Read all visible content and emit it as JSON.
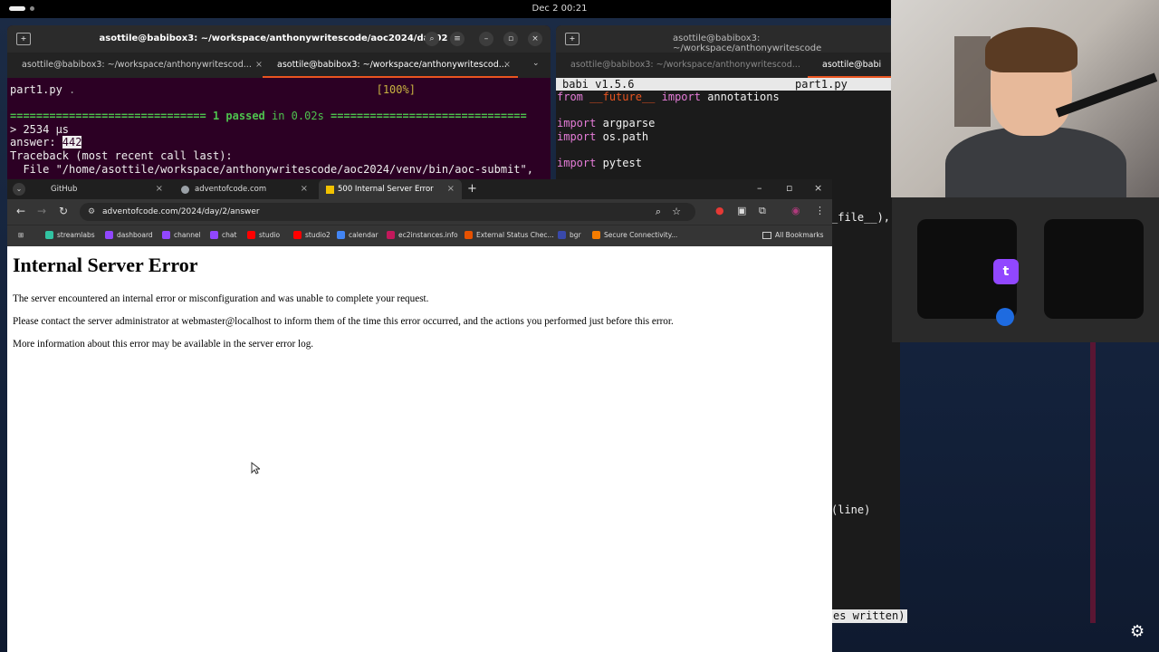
{
  "topbar": {
    "clock": "Dec 2  00:21"
  },
  "term1": {
    "title": "asottile@babibox3: ~/workspace/anthonywritescode/aoc2024/day02",
    "tabs": [
      "asottile@babibox3: ~/workspace/anthonywritescod...",
      "asottile@babibox3: ~/workspace/anthonywritescod..."
    ],
    "lines": {
      "test_file": "part1.py",
      "test_dot": " .",
      "test_pct": "[100%]",
      "sep_left": "============================== ",
      "passed": "1 passed",
      "in_time": " in 0.02s",
      "sep_right": " ==============================",
      "timing": "> 2534 µs",
      "answer_label": "answer: ",
      "answer_value": "442",
      "traceback": "Traceback (most recent call last):",
      "file_line": "  File \"/home/asottile/workspace/anthonywritescode/aoc2024/venv/bin/aoc-submit\","
    }
  },
  "term2": {
    "title": "asottile@babibox3: ~/workspace/anthonywritescode",
    "tabs": [
      "asottile@babibox3: ~/workspace/anthonywritescod...",
      "asottile@babi"
    ],
    "editor_name": "babi v1.5.6",
    "editor_file": "part1.py",
    "code": {
      "l1_kw1": "from",
      "l1_mod": "__future__",
      "l1_kw2": "import",
      "l1_name": " annotations",
      "l3_kw": "import",
      "l3_name": " argparse",
      "l4_kw": "import",
      "l4_name": " os.path",
      "l6_kw": "import",
      "l6_name": " pytest"
    },
    "fragments": {
      "file_frag": "_file__),",
      "line_frag": "(line)",
      "written_frag": "es written)"
    }
  },
  "browser": {
    "tabs": [
      {
        "label": "GitHub",
        "favicon_color": "#f0f0f0"
      },
      {
        "label": "adventofcode.com",
        "favicon_color": "#9aa0a6"
      },
      {
        "label": "500 Internal Server Error",
        "favicon_color": "#f2c200"
      }
    ],
    "url": "adventofcode.com/2024/day/2/answer",
    "bookmarks": [
      {
        "label": "streamlabs",
        "color": "#31c3a2"
      },
      {
        "label": "dashboard",
        "color": "#9147ff"
      },
      {
        "label": "channel",
        "color": "#9147ff"
      },
      {
        "label": "chat",
        "color": "#9147ff"
      },
      {
        "label": "studio",
        "color": "#ff0000"
      },
      {
        "label": "studio2",
        "color": "#ff0000"
      },
      {
        "label": "calendar",
        "color": "#4285f4"
      },
      {
        "label": "ec2instances.info",
        "color": "#c2185b"
      },
      {
        "label": "External Status Chec...",
        "color": "#e65100"
      },
      {
        "label": "bgr",
        "color": "#3949ab"
      },
      {
        "label": "Secure Connectivity...",
        "color": "#f57c00"
      }
    ],
    "all_bookmarks": "All Bookmarks",
    "page": {
      "heading": "Internal Server Error",
      "p1": "The server encountered an internal error or misconfiguration and was unable to complete your request.",
      "p2": "Please contact the server administrator at webmaster@localhost to inform them of the time this error occurred, and the actions you performed just before this error.",
      "p3": "More information about this error may be available in the server error log."
    }
  }
}
